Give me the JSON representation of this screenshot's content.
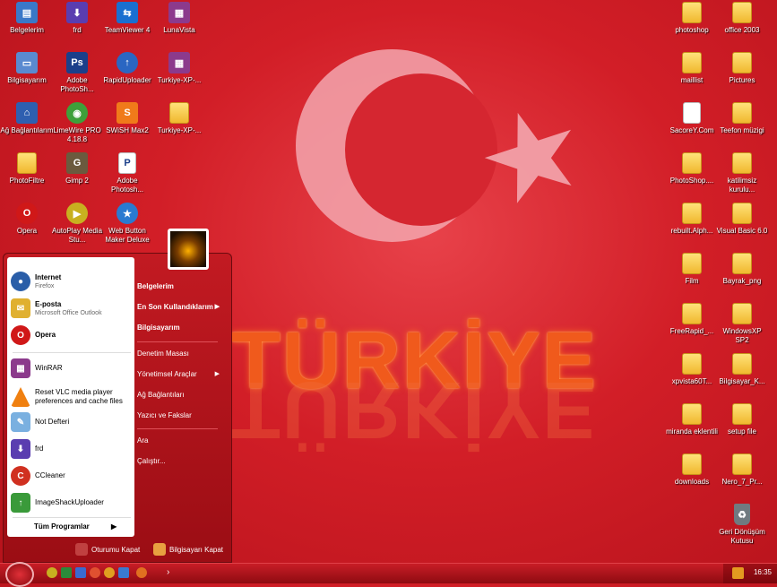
{
  "wallpaper": {
    "text": "TÜRKİYE"
  },
  "desktop_icons": [
    {
      "label": "Belgelerim",
      "icon": "my-documents-icon"
    },
    {
      "label": "frd",
      "icon": "download-arrow-icon"
    },
    {
      "label": "TeamViewer 4",
      "icon": "teamviewer-icon"
    },
    {
      "label": "LunaVista",
      "icon": "winrar-archive-icon"
    },
    {
      "label": "Bilgisayarım",
      "icon": "my-computer-icon"
    },
    {
      "label": "Adobe PhotoSh...",
      "icon": "photoshop-icon"
    },
    {
      "label": "RapidUploader",
      "icon": "rapiduploader-icon"
    },
    {
      "label": "Turkiye-XP-...",
      "icon": "winrar-archive-icon"
    },
    {
      "label": "Ağ Bağlantılarım",
      "icon": "network-icon"
    },
    {
      "label": "LimeWire PRO 4.18.8",
      "icon": "limewire-icon"
    },
    {
      "label": "SWiSH Max2",
      "icon": "swish-icon"
    },
    {
      "label": "Turkiye-XP-...",
      "icon": "folder-icon"
    },
    {
      "label": "PhotoFiltre",
      "icon": "folder-icon"
    },
    {
      "label": "Gimp 2",
      "icon": "gimp-icon"
    },
    {
      "label": "Adobe Photosh...",
      "icon": "photoshop-doc-icon"
    },
    {
      "label": "Opera",
      "icon": "opera-icon"
    },
    {
      "label": "AutoPlay Media Stu...",
      "icon": "autoplay-icon"
    },
    {
      "label": "Web Button Maker Deluxe",
      "icon": "web-button-icon"
    },
    {
      "label": "photoshop",
      "icon": "folder-icon"
    },
    {
      "label": "office 2003",
      "icon": "folder-icon"
    },
    {
      "label": "maillist",
      "icon": "folder-icon"
    },
    {
      "label": "Pictures",
      "icon": "folder-icon"
    },
    {
      "label": "SacoreY.Com",
      "icon": "document-icon"
    },
    {
      "label": "Teefon müzigi",
      "icon": "folder-icon"
    },
    {
      "label": "PhotoShop....",
      "icon": "folder-icon"
    },
    {
      "label": "katilimsiz kurulu...",
      "icon": "folder-icon"
    },
    {
      "label": "rebuilt.Alph...",
      "icon": "folder-icon"
    },
    {
      "label": "Visual Basic 6.0",
      "icon": "folder-icon"
    },
    {
      "label": "Film",
      "icon": "folder-icon"
    },
    {
      "label": "Bayrak_png",
      "icon": "folder-icon"
    },
    {
      "label": "FreeRapid_...",
      "icon": "folder-icon"
    },
    {
      "label": "WindowsXP SP2",
      "icon": "folder-icon"
    },
    {
      "label": "xpvista60T...",
      "icon": "folder-icon"
    },
    {
      "label": "Bilgisayar_K...",
      "icon": "folder-icon"
    },
    {
      "label": "miranda eklentili",
      "icon": "folder-icon"
    },
    {
      "label": "setup file",
      "icon": "folder-icon"
    },
    {
      "label": "downloads",
      "icon": "folder-icon"
    },
    {
      "label": "Nero_7_Pr...",
      "icon": "folder-icon"
    },
    {
      "label": "Geri Dönüşüm Kutusu",
      "icon": "recycle-bin-icon"
    }
  ],
  "start_menu": {
    "pinned": [
      {
        "title": "Internet",
        "subtitle": "Firefox",
        "icon": "firefox-icon"
      },
      {
        "title": "E-posta",
        "subtitle": "Microsoft Office Outlook",
        "icon": "outlook-icon"
      },
      {
        "title": "Opera",
        "subtitle": "",
        "icon": "opera-icon"
      }
    ],
    "recent": [
      {
        "title": "WinRAR",
        "icon": "winrar-icon"
      },
      {
        "title": "Reset VLC media player preferences and cache files",
        "icon": "vlc-icon"
      },
      {
        "title": "Not Defteri",
        "icon": "notepad-icon"
      },
      {
        "title": "frd",
        "icon": "download-arrow-icon"
      },
      {
        "title": "CCleaner",
        "icon": "ccleaner-icon"
      },
      {
        "title": "ImageShackUploader",
        "icon": "imageshack-icon"
      }
    ],
    "all_programs": "Tüm Programlar",
    "right": {
      "belgelerim": "Belgelerim",
      "recent_docs": "En Son Kullandıklarım",
      "bilgisayarim": "Bilgisayarım",
      "control_panel": "Denetim Masası",
      "admin_tools": "Yönetimsel Araçlar",
      "network": "Ağ Bağlantıları",
      "printers": "Yazıcı ve Fakslar",
      "search": "Ara",
      "run": "Çalıştır..."
    },
    "logoff": "Oturumu Kapat",
    "shutdown": "Bilgisayarı Kapat"
  },
  "taskbar": {
    "clock": "16:35",
    "expand": "›",
    "collapse": "‹"
  },
  "colors": {
    "accent": "#c81d26",
    "dark": "#8e0b11",
    "flag_white": "#f3a6ae"
  }
}
